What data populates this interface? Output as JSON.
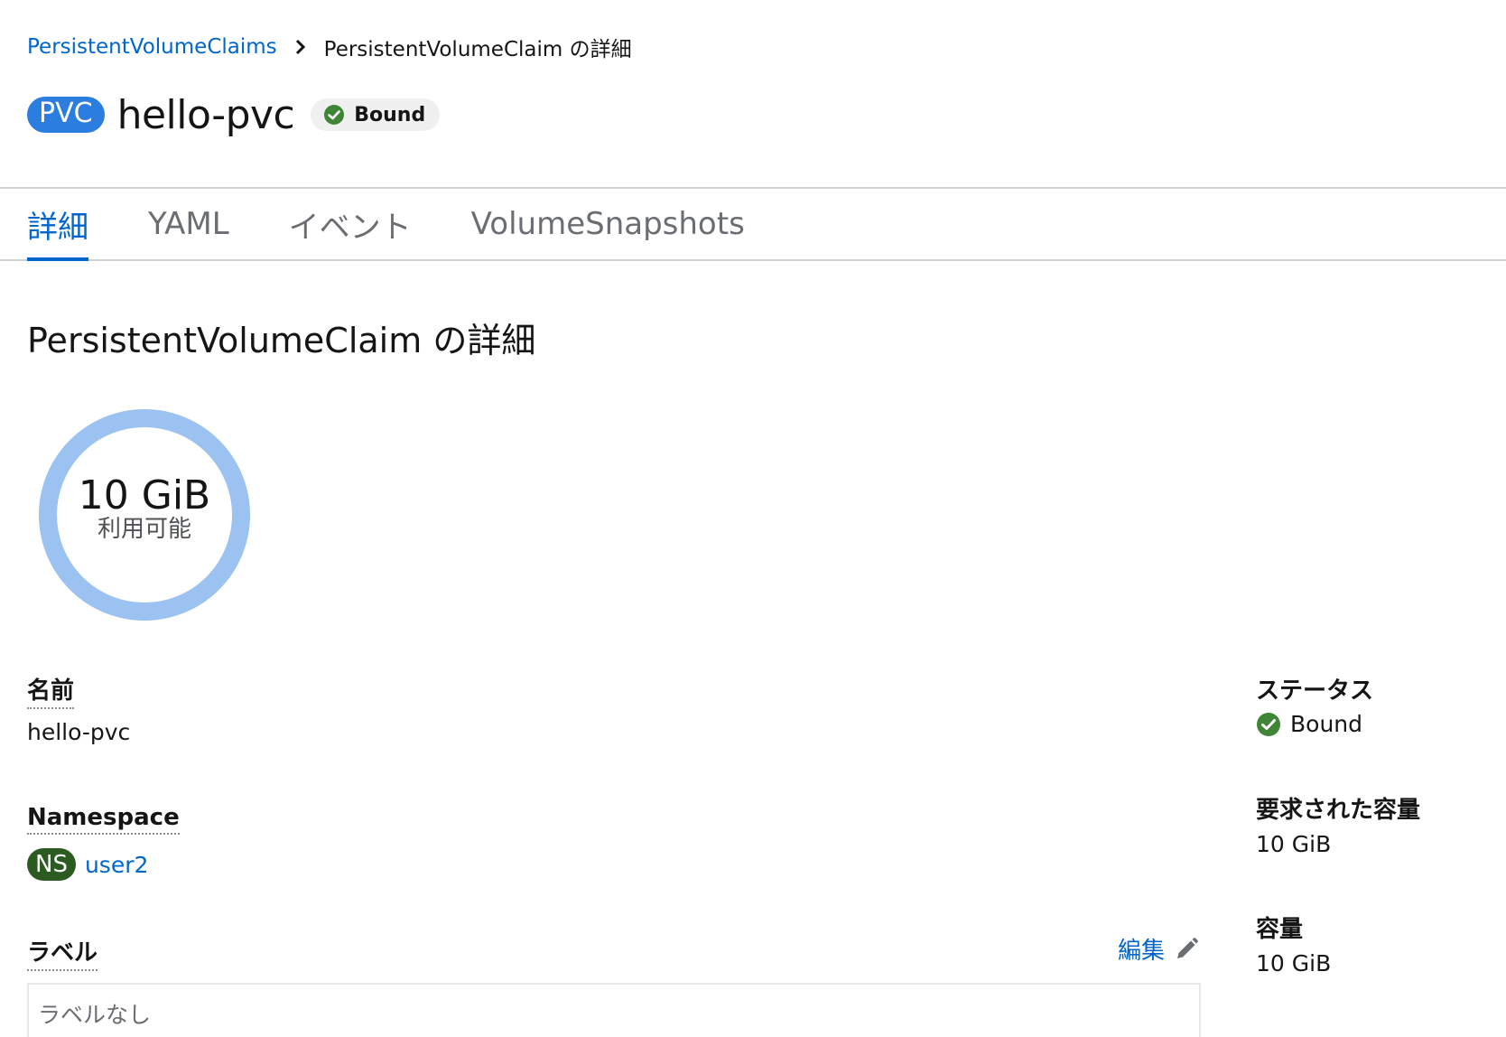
{
  "breadcrumb": {
    "parent": "PersistentVolumeClaims",
    "current": "PersistentVolumeClaim の詳細"
  },
  "header": {
    "kind_badge": "PVC",
    "title": "hello-pvc",
    "status": "Bound"
  },
  "tabs": [
    {
      "label": "詳細",
      "active": true
    },
    {
      "label": "YAML",
      "active": false
    },
    {
      "label": "イベント",
      "active": false
    },
    {
      "label": "VolumeSnapshots",
      "active": false
    }
  ],
  "section": {
    "title": "PersistentVolumeClaim の詳細"
  },
  "donut": {
    "value": "10 GiB",
    "label": "利用可能"
  },
  "details_left": {
    "name_label": "名前",
    "name_value": "hello-pvc",
    "namespace_label": "Namespace",
    "namespace_badge": "NS",
    "namespace_value": "user2",
    "labels_label": "ラベル",
    "labels_edit": "編集",
    "labels_empty": "ラベルなし"
  },
  "details_right": {
    "status_label": "ステータス",
    "status_value": "Bound",
    "requested_label": "要求された容量",
    "requested_value": "10 GiB",
    "capacity_label": "容量",
    "capacity_value": "10 GiB"
  },
  "colors": {
    "link": "#0066cc",
    "pvc_badge": "#2b7de0",
    "ns_badge": "#2c5b22",
    "success": "#3e8635",
    "donut_ring": "#9bc2f0"
  },
  "icons": {
    "breadcrumb_separator": "chevron-right-icon",
    "status": "check-circle-icon",
    "edit": "pencil-icon"
  }
}
